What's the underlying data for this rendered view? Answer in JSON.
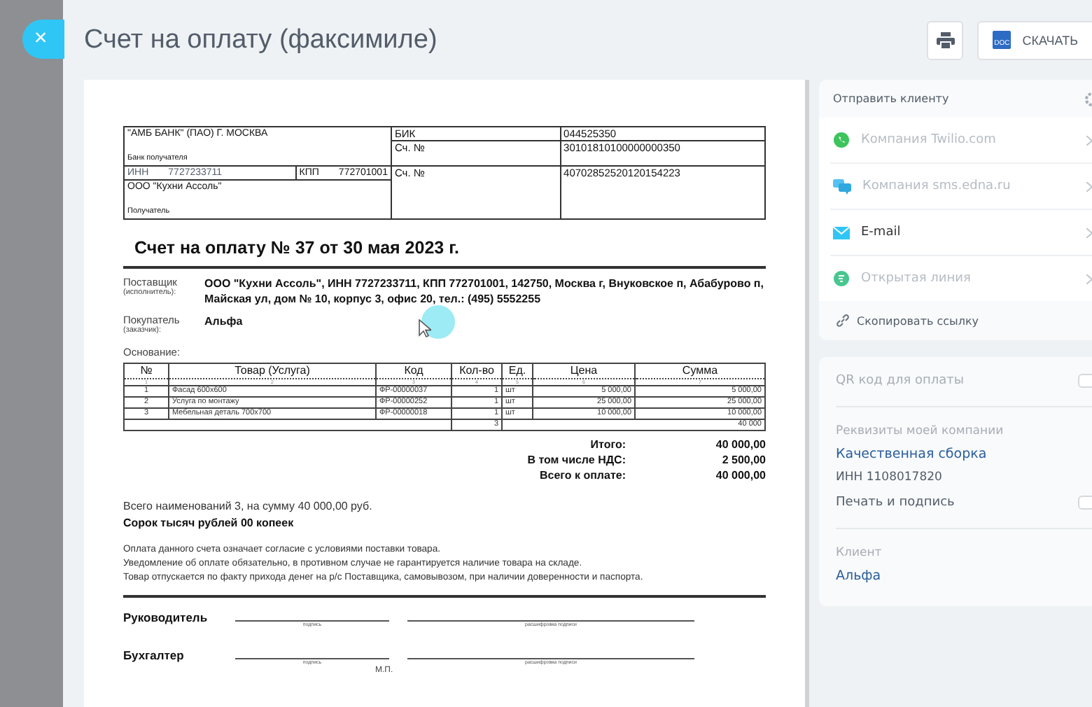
{
  "close_button": {
    "label": "×"
  },
  "header": {
    "title": "Счет на оплату (факсимиле)",
    "download_button": {
      "label": "СКАЧАТЬ",
      "badge": "DOC"
    }
  },
  "invoice": {
    "bank": {
      "name": "\"АМБ БАНК\" (ПАО) Г. МОСКВА",
      "name_label": "Банк получателя",
      "bik_label": "БИК",
      "bik": "044525350",
      "corr_label": "Сч. №",
      "corr_account": "30101810100000000350",
      "inn_label": "ИНН",
      "inn": "7727233711",
      "kpp_label": "КПП",
      "kpp": "772701001",
      "recipient": "ООО \"Кухни Ассоль\"",
      "recipient_label": "Получатель",
      "account_label": "Сч. №",
      "account": "40702852520120154223"
    },
    "title": "Счет на оплату № 37 от 30 мая 2023 г.",
    "parties": [
      {
        "label": "Поставщик",
        "sublabel": "(исполнитель):",
        "value": "ООО \"Кухни Ассоль\",  ИНН 7727233711,  КПП 772701001,  142750, Москва г, Внуковское п, Абабурово п, Майская ул, дом № 10, корпус 3, офис 20,  тел.: (495) 5552255"
      },
      {
        "label": "Покупатель",
        "sublabel": "(заказчик):",
        "value": "Альфа"
      }
    ],
    "basis_label": "Основание:",
    "columns": [
      {
        "label": "№",
        "number": "1"
      },
      {
        "label": "Товар (Услуга)",
        "number": "2"
      },
      {
        "label": "Код",
        "number": "3"
      },
      {
        "label": "Кол-во",
        "number": "4"
      },
      {
        "label": "Ед.",
        "number": "5"
      },
      {
        "label": "Цена",
        "number": "6"
      },
      {
        "label": "Сумма",
        "number": "7"
      }
    ],
    "rows": [
      [
        "1",
        "Фасад 600х600",
        "ФР-00000037",
        "1",
        "шт",
        "5 000,00",
        "5 000,00"
      ],
      [
        "2",
        "Услуга по монтажу",
        "ФР-00000252",
        "1",
        "шт",
        "25 000,00",
        "25 000,00"
      ],
      [
        "3",
        "Мебельная деталь 700х700",
        "ФР-00000018",
        "1",
        "шт",
        "10 000,00",
        "10 000,00"
      ]
    ],
    "total_row": {
      "quantity": "3",
      "sum": "40 000"
    },
    "totals": [
      {
        "label": "Итого:",
        "value": "40 000,00"
      },
      {
        "label": "В том числе НДС:",
        "value": "2 500,00"
      },
      {
        "label": "Всего к оплате:",
        "value": "40 000,00"
      }
    ],
    "summary": "Всего наименований 3, на сумму 40 000,00 руб.",
    "amount_words": "Сорок тысяч рублей 00 копеек",
    "notes": [
      "Оплата данного счета означает согласие с условиями поставки товара.",
      "Уведомление об оплате обязательно, в противном случае не гарантируется наличие товара на складе.",
      "Товар отпускается по факту прихода денег на р/с Поставщика, самовывозом, при наличии доверенности и паспорта."
    ],
    "signatures": [
      {
        "label": "Руководитель",
        "sign_caption": "подпись",
        "decode_caption": "расшифровка подписи"
      },
      {
        "label": "Бухгалтер",
        "sign_caption": "подпись",
        "decode_caption": "расшифровка подписи"
      }
    ],
    "stamp": "М.П."
  },
  "send_panel": {
    "title": "Отправить клиенту",
    "channels": [
      {
        "name": "Компания Twilio.com",
        "kind": "whatsapp",
        "disabled": true
      },
      {
        "name": "Компания sms.edna.ru",
        "kind": "sms",
        "disabled": true
      },
      {
        "name": "E-mail",
        "kind": "email",
        "disabled": false
      },
      {
        "name": "Открытая линия",
        "kind": "openline",
        "disabled": true
      }
    ],
    "copy_link": "Скопировать ссылку"
  },
  "settings_panel": {
    "qr": {
      "label": "QR код для оплаты",
      "on": false
    },
    "company_label": "Реквизиты моей компании",
    "company_name": "Качественная сборка",
    "company_inn": "ИНН 1108017820",
    "stamp": {
      "label": "Печать и подпись",
      "on": false
    },
    "client_label": "Клиент",
    "client_name": "Альфа"
  }
}
